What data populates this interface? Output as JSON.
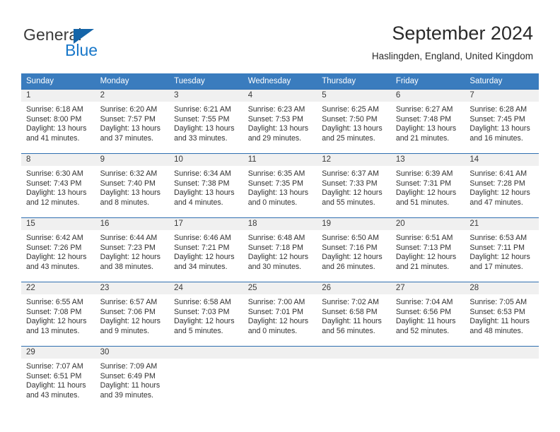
{
  "brand": {
    "name_top": "General",
    "name_bottom": "Blue",
    "accent_color": "#1877c9",
    "triangle_color": "#1565a8"
  },
  "header": {
    "title": "September 2024",
    "subtitle": "Haslingden, England, United Kingdom"
  },
  "calendar": {
    "header_bg": "#3a7cbe",
    "daynum_bg": "#f0f0f0",
    "row_divider_color": "#2f6fb0",
    "weekday_headers": [
      "Sunday",
      "Monday",
      "Tuesday",
      "Wednesday",
      "Thursday",
      "Friday",
      "Saturday"
    ],
    "weeks": [
      [
        {
          "day": "1",
          "sunrise": "Sunrise: 6:18 AM",
          "sunset": "Sunset: 8:00 PM",
          "daylight_line1": "Daylight: 13 hours",
          "daylight_line2": "and 41 minutes."
        },
        {
          "day": "2",
          "sunrise": "Sunrise: 6:20 AM",
          "sunset": "Sunset: 7:57 PM",
          "daylight_line1": "Daylight: 13 hours",
          "daylight_line2": "and 37 minutes."
        },
        {
          "day": "3",
          "sunrise": "Sunrise: 6:21 AM",
          "sunset": "Sunset: 7:55 PM",
          "daylight_line1": "Daylight: 13 hours",
          "daylight_line2": "and 33 minutes."
        },
        {
          "day": "4",
          "sunrise": "Sunrise: 6:23 AM",
          "sunset": "Sunset: 7:53 PM",
          "daylight_line1": "Daylight: 13 hours",
          "daylight_line2": "and 29 minutes."
        },
        {
          "day": "5",
          "sunrise": "Sunrise: 6:25 AM",
          "sunset": "Sunset: 7:50 PM",
          "daylight_line1": "Daylight: 13 hours",
          "daylight_line2": "and 25 minutes."
        },
        {
          "day": "6",
          "sunrise": "Sunrise: 6:27 AM",
          "sunset": "Sunset: 7:48 PM",
          "daylight_line1": "Daylight: 13 hours",
          "daylight_line2": "and 21 minutes."
        },
        {
          "day": "7",
          "sunrise": "Sunrise: 6:28 AM",
          "sunset": "Sunset: 7:45 PM",
          "daylight_line1": "Daylight: 13 hours",
          "daylight_line2": "and 16 minutes."
        }
      ],
      [
        {
          "day": "8",
          "sunrise": "Sunrise: 6:30 AM",
          "sunset": "Sunset: 7:43 PM",
          "daylight_line1": "Daylight: 13 hours",
          "daylight_line2": "and 12 minutes."
        },
        {
          "day": "9",
          "sunrise": "Sunrise: 6:32 AM",
          "sunset": "Sunset: 7:40 PM",
          "daylight_line1": "Daylight: 13 hours",
          "daylight_line2": "and 8 minutes."
        },
        {
          "day": "10",
          "sunrise": "Sunrise: 6:34 AM",
          "sunset": "Sunset: 7:38 PM",
          "daylight_line1": "Daylight: 13 hours",
          "daylight_line2": "and 4 minutes."
        },
        {
          "day": "11",
          "sunrise": "Sunrise: 6:35 AM",
          "sunset": "Sunset: 7:35 PM",
          "daylight_line1": "Daylight: 13 hours",
          "daylight_line2": "and 0 minutes."
        },
        {
          "day": "12",
          "sunrise": "Sunrise: 6:37 AM",
          "sunset": "Sunset: 7:33 PM",
          "daylight_line1": "Daylight: 12 hours",
          "daylight_line2": "and 55 minutes."
        },
        {
          "day": "13",
          "sunrise": "Sunrise: 6:39 AM",
          "sunset": "Sunset: 7:31 PM",
          "daylight_line1": "Daylight: 12 hours",
          "daylight_line2": "and 51 minutes."
        },
        {
          "day": "14",
          "sunrise": "Sunrise: 6:41 AM",
          "sunset": "Sunset: 7:28 PM",
          "daylight_line1": "Daylight: 12 hours",
          "daylight_line2": "and 47 minutes."
        }
      ],
      [
        {
          "day": "15",
          "sunrise": "Sunrise: 6:42 AM",
          "sunset": "Sunset: 7:26 PM",
          "daylight_line1": "Daylight: 12 hours",
          "daylight_line2": "and 43 minutes."
        },
        {
          "day": "16",
          "sunrise": "Sunrise: 6:44 AM",
          "sunset": "Sunset: 7:23 PM",
          "daylight_line1": "Daylight: 12 hours",
          "daylight_line2": "and 38 minutes."
        },
        {
          "day": "17",
          "sunrise": "Sunrise: 6:46 AM",
          "sunset": "Sunset: 7:21 PM",
          "daylight_line1": "Daylight: 12 hours",
          "daylight_line2": "and 34 minutes."
        },
        {
          "day": "18",
          "sunrise": "Sunrise: 6:48 AM",
          "sunset": "Sunset: 7:18 PM",
          "daylight_line1": "Daylight: 12 hours",
          "daylight_line2": "and 30 minutes."
        },
        {
          "day": "19",
          "sunrise": "Sunrise: 6:50 AM",
          "sunset": "Sunset: 7:16 PM",
          "daylight_line1": "Daylight: 12 hours",
          "daylight_line2": "and 26 minutes."
        },
        {
          "day": "20",
          "sunrise": "Sunrise: 6:51 AM",
          "sunset": "Sunset: 7:13 PM",
          "daylight_line1": "Daylight: 12 hours",
          "daylight_line2": "and 21 minutes."
        },
        {
          "day": "21",
          "sunrise": "Sunrise: 6:53 AM",
          "sunset": "Sunset: 7:11 PM",
          "daylight_line1": "Daylight: 12 hours",
          "daylight_line2": "and 17 minutes."
        }
      ],
      [
        {
          "day": "22",
          "sunrise": "Sunrise: 6:55 AM",
          "sunset": "Sunset: 7:08 PM",
          "daylight_line1": "Daylight: 12 hours",
          "daylight_line2": "and 13 minutes."
        },
        {
          "day": "23",
          "sunrise": "Sunrise: 6:57 AM",
          "sunset": "Sunset: 7:06 PM",
          "daylight_line1": "Daylight: 12 hours",
          "daylight_line2": "and 9 minutes."
        },
        {
          "day": "24",
          "sunrise": "Sunrise: 6:58 AM",
          "sunset": "Sunset: 7:03 PM",
          "daylight_line1": "Daylight: 12 hours",
          "daylight_line2": "and 5 minutes."
        },
        {
          "day": "25",
          "sunrise": "Sunrise: 7:00 AM",
          "sunset": "Sunset: 7:01 PM",
          "daylight_line1": "Daylight: 12 hours",
          "daylight_line2": "and 0 minutes."
        },
        {
          "day": "26",
          "sunrise": "Sunrise: 7:02 AM",
          "sunset": "Sunset: 6:58 PM",
          "daylight_line1": "Daylight: 11 hours",
          "daylight_line2": "and 56 minutes."
        },
        {
          "day": "27",
          "sunrise": "Sunrise: 7:04 AM",
          "sunset": "Sunset: 6:56 PM",
          "daylight_line1": "Daylight: 11 hours",
          "daylight_line2": "and 52 minutes."
        },
        {
          "day": "28",
          "sunrise": "Sunrise: 7:05 AM",
          "sunset": "Sunset: 6:53 PM",
          "daylight_line1": "Daylight: 11 hours",
          "daylight_line2": "and 48 minutes."
        }
      ],
      [
        {
          "day": "29",
          "sunrise": "Sunrise: 7:07 AM",
          "sunset": "Sunset: 6:51 PM",
          "daylight_line1": "Daylight: 11 hours",
          "daylight_line2": "and 43 minutes."
        },
        {
          "day": "30",
          "sunrise": "Sunrise: 7:09 AM",
          "sunset": "Sunset: 6:49 PM",
          "daylight_line1": "Daylight: 11 hours",
          "daylight_line2": "and 39 minutes."
        },
        {
          "day": "",
          "sunrise": "",
          "sunset": "",
          "daylight_line1": "",
          "daylight_line2": ""
        },
        {
          "day": "",
          "sunrise": "",
          "sunset": "",
          "daylight_line1": "",
          "daylight_line2": ""
        },
        {
          "day": "",
          "sunrise": "",
          "sunset": "",
          "daylight_line1": "",
          "daylight_line2": ""
        },
        {
          "day": "",
          "sunrise": "",
          "sunset": "",
          "daylight_line1": "",
          "daylight_line2": ""
        },
        {
          "day": "",
          "sunrise": "",
          "sunset": "",
          "daylight_line1": "",
          "daylight_line2": ""
        }
      ]
    ]
  }
}
